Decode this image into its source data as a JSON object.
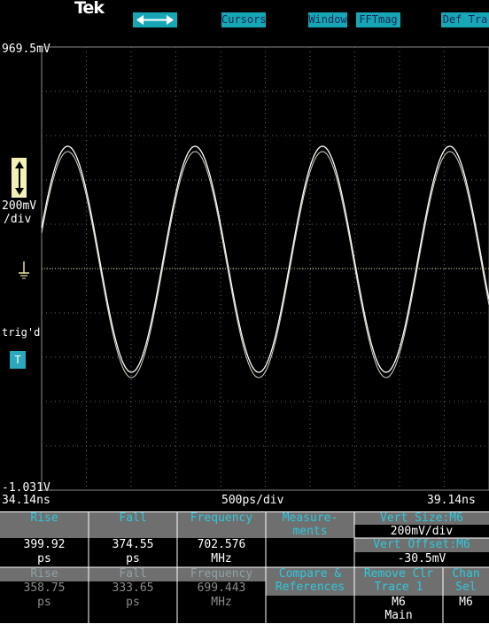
{
  "brand": "Tek",
  "toolbar": {
    "arrow_button_icon": "horizontal-arrows-icon",
    "cursors": "Cursors",
    "window": "Window",
    "fftmag": "FFTmag",
    "deftrace": "Def Tra"
  },
  "scope": {
    "top_voltage": "969.5mV",
    "bottom_voltage": "-1.031V",
    "vertical_scale": "200mV",
    "vertical_unit": "/div",
    "trig_label": "trig'd",
    "trig_marker": "T",
    "time_start": "34.14ns",
    "time_per_div": "500ps/div",
    "time_end": "39.14ns"
  },
  "waveform": {
    "frequency_mhz": 702.576,
    "amplitude_divs": 2.55,
    "center_div": 4.85,
    "phase_offset_ns": 0.42,
    "color": "#ffffff",
    "ground_color": "#e8e3a0"
  },
  "measurements": {
    "headers": [
      "Rise",
      "Fall",
      "Frequency"
    ],
    "values": [
      "399.92",
      "374.55",
      "702.576"
    ],
    "units": [
      "ps",
      "ps",
      "MHz"
    ],
    "prev_values": [
      "358.75",
      "333.65",
      "699.443"
    ],
    "prev_units": [
      "ps",
      "ps",
      "MHz"
    ]
  },
  "menu": {
    "measurements": "Measure-\nments",
    "vert_size_label": "Vert Size:M6",
    "vert_size_value": "200mV/div",
    "vert_offset_label": "Vert Offset:M6",
    "vert_offset_value": "-30.5mV",
    "compare": "Compare &\nReferences",
    "remove": "Remove Clr\nTrace 1",
    "chan": "Chan\nSel",
    "remove_value": "M6\nMain",
    "chan_value": "M6"
  }
}
